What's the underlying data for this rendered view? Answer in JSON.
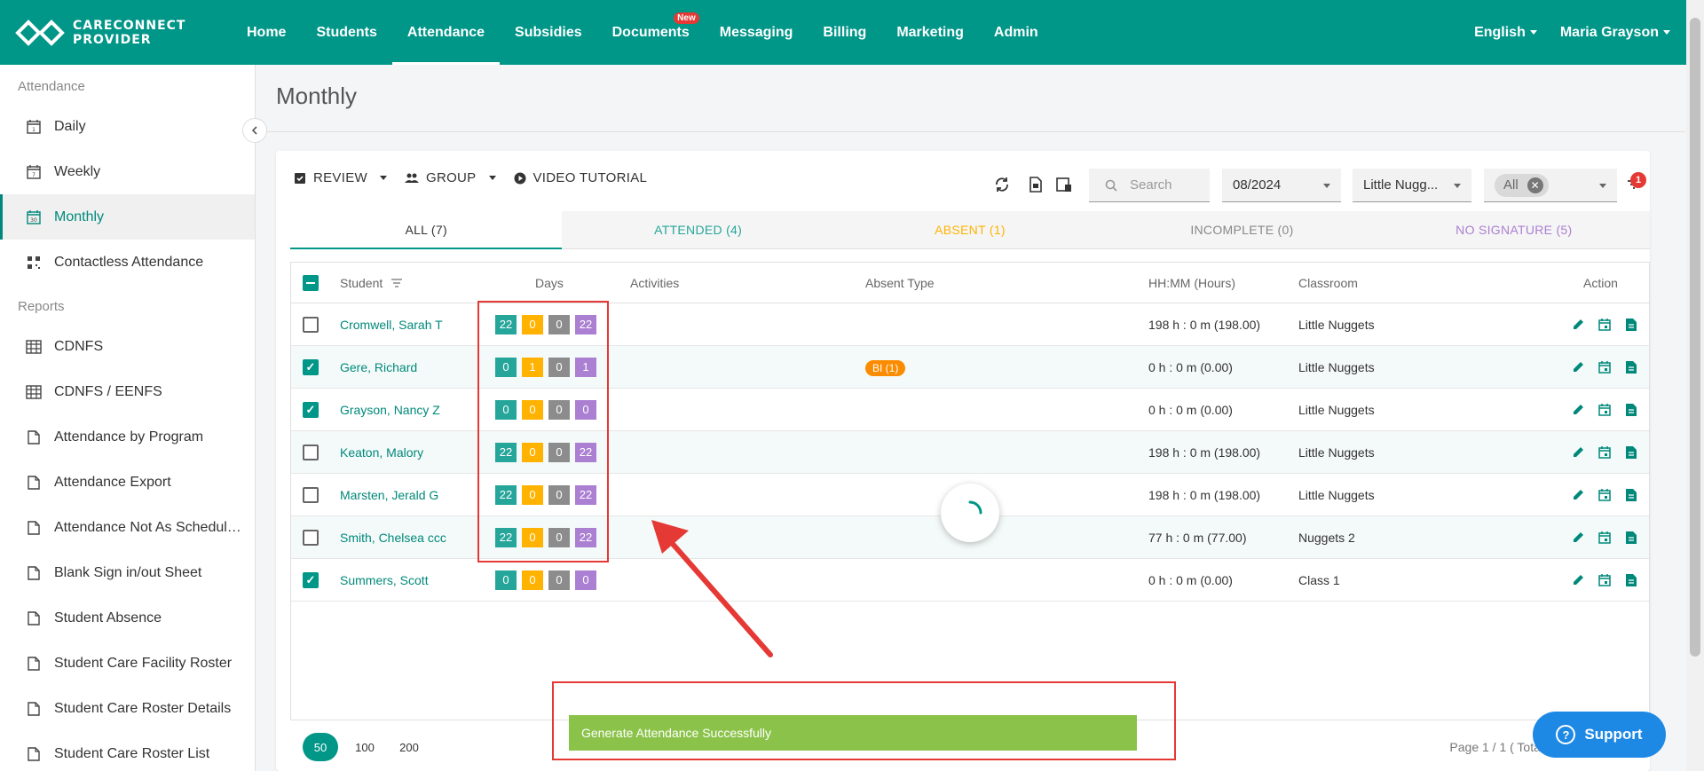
{
  "brand": {
    "line1": "CARECONNECT",
    "line2": "PROVIDER"
  },
  "nav": [
    {
      "label": "Home"
    },
    {
      "label": "Students"
    },
    {
      "label": "Attendance",
      "active": true
    },
    {
      "label": "Subsidies"
    },
    {
      "label": "Documents",
      "badge": "New"
    },
    {
      "label": "Messaging"
    },
    {
      "label": "Billing"
    },
    {
      "label": "Marketing"
    },
    {
      "label": "Admin"
    }
  ],
  "top_right": {
    "language": "English",
    "user": "Maria Grayson"
  },
  "sidebar": {
    "section_attendance": "Attendance",
    "attendance_items": [
      {
        "label": "Daily",
        "icon": "calendar-1-icon"
      },
      {
        "label": "Weekly",
        "icon": "calendar-7-icon"
      },
      {
        "label": "Monthly",
        "icon": "calendar-30-icon"
      },
      {
        "label": "Contactless Attendance",
        "icon": "qr-code-icon"
      }
    ],
    "section_reports": "Reports",
    "report_items": [
      {
        "label": "CDNFS",
        "icon": "table-icon"
      },
      {
        "label": "CDNFS / EENFS",
        "icon": "table-icon"
      },
      {
        "label": "Attendance by Program",
        "icon": "document-icon"
      },
      {
        "label": "Attendance Export",
        "icon": "document-icon"
      },
      {
        "label": "Attendance Not As Scheduled",
        "icon": "document-icon"
      },
      {
        "label": "Blank Sign in/out Sheet",
        "icon": "document-icon"
      },
      {
        "label": "Student Absence",
        "icon": "document-icon"
      },
      {
        "label": "Student Care Facility Roster",
        "icon": "document-icon"
      },
      {
        "label": "Student Care Roster Details",
        "icon": "document-icon"
      },
      {
        "label": "Student Care Roster List",
        "icon": "document-icon"
      }
    ]
  },
  "page": {
    "title": "Monthly"
  },
  "toolbar": {
    "review": "REVIEW",
    "group": "GROUP",
    "video": "VIDEO TUTORIAL"
  },
  "filters": {
    "search_placeholder": "Search",
    "month": "08/2024",
    "classroom": "Little Nugg...",
    "chip": "All",
    "filter_count": "1"
  },
  "tabs": [
    {
      "label": "ALL (7)",
      "color": "#333333"
    },
    {
      "label": "ATTENDED (4)",
      "color": "#26a69a"
    },
    {
      "label": "ABSENT (1)",
      "color": "#ffb300"
    },
    {
      "label": "INCOMPLETE (0)",
      "color": "#888888"
    },
    {
      "label": "NO SIGNATURE (5)",
      "color": "#ab7fd1"
    }
  ],
  "table": {
    "headers": {
      "student": "Student",
      "days": "Days",
      "activities": "Activities",
      "absent_type": "Absent Type",
      "hours": "HH:MM (Hours)",
      "classroom": "Classroom",
      "action": "Action"
    },
    "day_colors": [
      "#26a69a",
      "#ffb300",
      "#8c8c8c",
      "#ab7fd1"
    ],
    "rows": [
      {
        "student": "Cromwell, Sarah T",
        "days": [
          "22",
          "0",
          "0",
          "22"
        ],
        "absent": "",
        "hours": "198 h : 0 m (198.00)",
        "classroom": "Little Nuggets",
        "checked": false
      },
      {
        "student": "Gere, Richard",
        "days": [
          "0",
          "1",
          "0",
          "1"
        ],
        "absent": "BI (1)",
        "hours": "0 h : 0 m (0.00)",
        "classroom": "Little Nuggets",
        "checked": true
      },
      {
        "student": "Grayson, Nancy Z",
        "days": [
          "0",
          "0",
          "0",
          "0"
        ],
        "absent": "",
        "hours": "0 h : 0 m (0.00)",
        "classroom": "Little Nuggets",
        "checked": true
      },
      {
        "student": "Keaton, Malory",
        "days": [
          "22",
          "0",
          "0",
          "22"
        ],
        "absent": "",
        "hours": "198 h : 0 m (198.00)",
        "classroom": "Little Nuggets",
        "checked": false
      },
      {
        "student": "Marsten, Jerald G",
        "days": [
          "22",
          "0",
          "0",
          "22"
        ],
        "absent": "",
        "hours": "198 h : 0 m (198.00)",
        "classroom": "Little Nuggets",
        "checked": false
      },
      {
        "student": "Smith, Chelsea ccc",
        "days": [
          "22",
          "0",
          "0",
          "22"
        ],
        "absent": "",
        "hours": "77 h : 0 m (77.00)",
        "classroom": "Nuggets 2",
        "checked": false
      },
      {
        "student": "Summers, Scott",
        "days": [
          "0",
          "0",
          "0",
          "0"
        ],
        "absent": "",
        "hours": "0 h : 0 m (0.00)",
        "classroom": "Class 1",
        "checked": true
      }
    ]
  },
  "pager": {
    "sizes": [
      "50",
      "100",
      "200"
    ],
    "active": "50",
    "info": "Page 1 / 1 ( Total"
  },
  "toast": {
    "message": "Generate Attendance Successfully"
  },
  "support": {
    "label": "Support"
  },
  "colors": {
    "primary": "#009688",
    "accent_red": "#e53935",
    "toast_green": "#8bc34a",
    "support_blue": "#1e88e5"
  }
}
